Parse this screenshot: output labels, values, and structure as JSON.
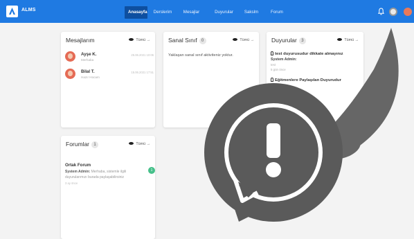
{
  "brand": "ALMS",
  "nav": {
    "items": [
      {
        "label": "Anasayfa",
        "active": true
      },
      {
        "label": "Derslerim",
        "active": false
      },
      {
        "label": "Mesajlar",
        "active": false
      },
      {
        "label": "Duyurular",
        "active": false
      },
      {
        "label": "Sakslm",
        "active": false
      },
      {
        "label": "Forum",
        "active": false
      }
    ]
  },
  "header_icons": [
    "bell-icon",
    "settings-icon",
    "user-avatar"
  ],
  "colors": {
    "topbar": "#1f7ae2",
    "active_tab": "#0e4fa0",
    "badge_green": "#46c08a",
    "overlay": "#555555"
  },
  "see_all_label": "Tümü →",
  "messages": {
    "title": "Mesajlarım",
    "items": [
      {
        "name": "Ayşe K.",
        "text": "Merhaba",
        "date": "25.06.2021 10:06"
      },
      {
        "name": "Bilal T.",
        "text": "Hazır Hocam",
        "date": "15.06.2021 17:51"
      }
    ]
  },
  "virtual_class": {
    "title": "Sanal Sınıf",
    "count": "0",
    "empty_text": "Yaklaşan sanal sınıf aktiviteniz yoktur."
  },
  "announcements": {
    "title": "Duyurular",
    "count": "3",
    "items": [
      {
        "title": "test duyurusudur dikkate almayınız",
        "author": "System Admin:",
        "body": "test",
        "time": "5 gün önce"
      },
      {
        "title": "Eğitmenlere Paylaşılan Duyurudur",
        "author": "",
        "body": "",
        "time": ""
      }
    ]
  },
  "forums": {
    "title": "Forumlar",
    "count": "1",
    "forum_title": "Ortak Forum",
    "author": "System Admin:",
    "text": "Merhaba, sistemle ilgili duyurularımızı burada paylaşabilirsiniz",
    "time": "3 ay önce",
    "badge": "1"
  },
  "overlay": {
    "symbol": "!"
  }
}
